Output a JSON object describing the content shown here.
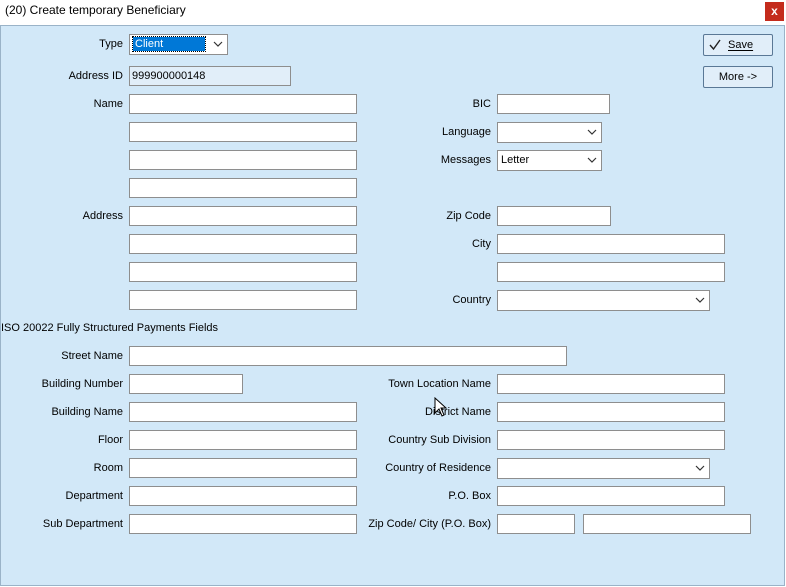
{
  "window": {
    "title": "(20) Create temporary Beneficiary",
    "close_label": "x"
  },
  "buttons": {
    "save": "Save",
    "more": "More ->"
  },
  "labels": {
    "type": "Type",
    "address_id": "Address ID",
    "name": "Name",
    "address": "Address",
    "bic": "BIC",
    "language": "Language",
    "messages": "Messages",
    "zip_code": "Zip Code",
    "city": "City",
    "country": "Country",
    "section_iso": "ISO 20022 Fully Structured Payments Fields",
    "street_name": "Street Name",
    "building_number": "Building Number",
    "building_name": "Building Name",
    "floor": "Floor",
    "room": "Room",
    "department": "Department",
    "sub_department": "Sub Department",
    "town_location_name": "Town Location Name",
    "district_name": "District Name",
    "country_sub_division": "Country Sub Division",
    "country_of_residence": "Country of Residence",
    "po_box": "P.O. Box",
    "zip_city_po_box": "Zip Code/ City (P.O. Box)"
  },
  "values": {
    "type": "Client",
    "address_id": "999900000148",
    "messages": "Letter",
    "language": "",
    "country": "",
    "country_of_residence": ""
  }
}
